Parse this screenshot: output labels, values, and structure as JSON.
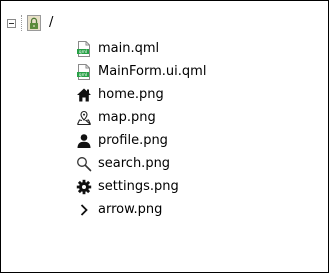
{
  "tree": {
    "root": {
      "label": "/",
      "icon": "lock-folder-icon",
      "expanded": true
    },
    "items": [
      {
        "label": "main.qml",
        "icon": "qml-file-icon"
      },
      {
        "label": "MainForm.ui.qml",
        "icon": "qml-file-icon"
      },
      {
        "label": "home.png",
        "icon": "home-icon"
      },
      {
        "label": "map.png",
        "icon": "map-icon"
      },
      {
        "label": "profile.png",
        "icon": "person-icon"
      },
      {
        "label": "search.png",
        "icon": "search-icon"
      },
      {
        "label": "settings.png",
        "icon": "gear-icon"
      },
      {
        "label": "arrow.png",
        "icon": "chevron-right-icon"
      }
    ],
    "colors": {
      "qml_badge": "#27a046",
      "border": "#000000",
      "background": "#ffffff"
    }
  }
}
